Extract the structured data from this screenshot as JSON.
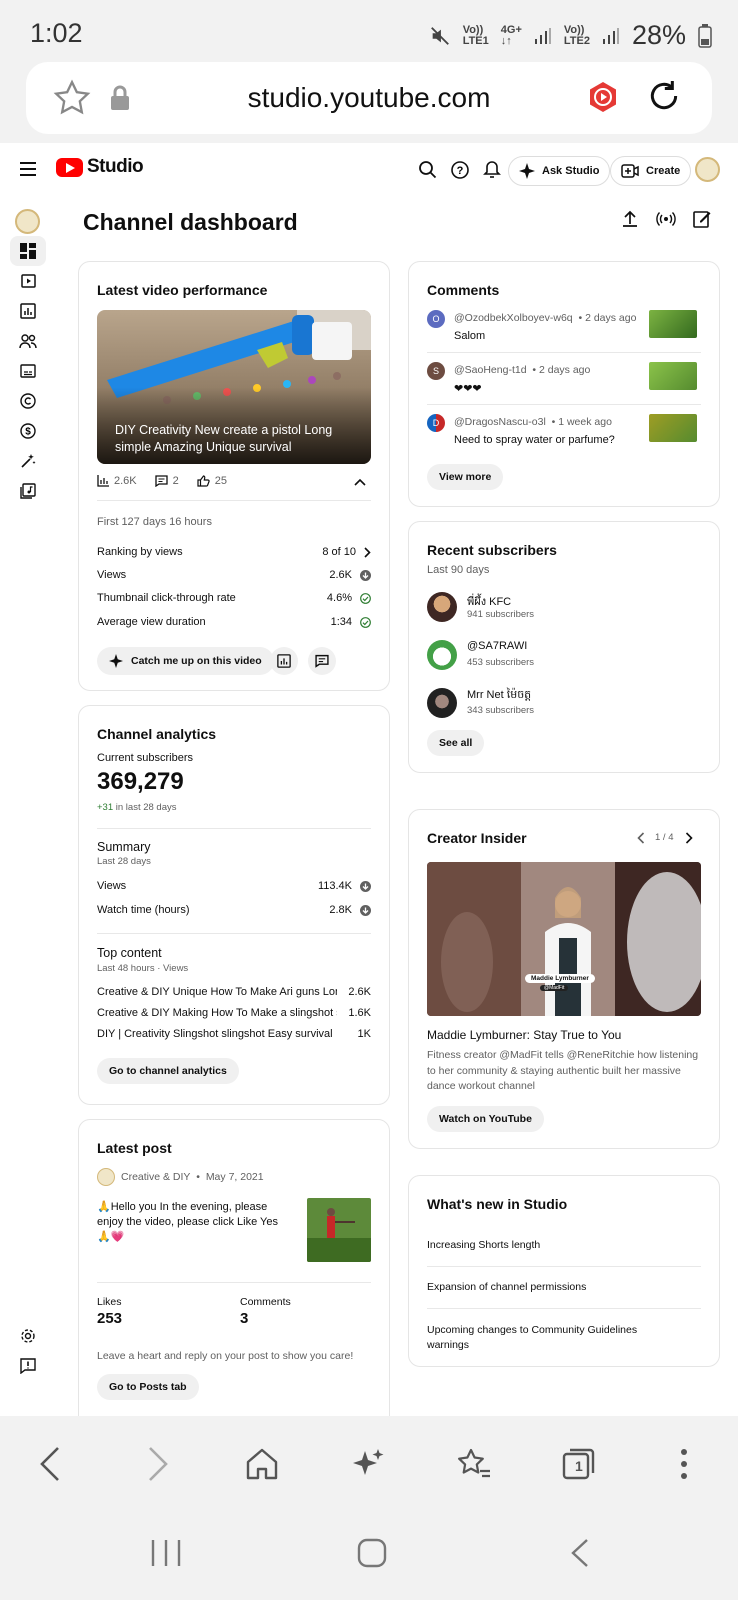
{
  "status": {
    "time": "1:02",
    "net1_top": "Vo))",
    "net1_bottom": "LTE1",
    "net2_top": "4G+",
    "net2_bottom": "↓↑",
    "net3_top": "Vo))",
    "net3_bottom": "LTE2",
    "battery": "28%"
  },
  "browser": {
    "url": "studio.youtube.com"
  },
  "header": {
    "logo_text": "Studio",
    "ask_studio": "Ask Studio",
    "create": "Create"
  },
  "dashboard": {
    "title": "Channel dashboard"
  },
  "latest_video": {
    "title": "Latest video performance",
    "video_title": "DIY Creativity New create a pistol Long simple Amazing Unique survival",
    "views_stat": "2.6K",
    "comments_stat": "2",
    "likes_stat": "25",
    "period": "First 127 days 16 hours",
    "rows": [
      {
        "label": "Ranking by views",
        "value": "8 of 10"
      },
      {
        "label": "Views",
        "value": "2.6K"
      },
      {
        "label": "Thumbnail click-through rate",
        "value": "4.6%"
      },
      {
        "label": "Average view duration",
        "value": "1:34"
      }
    ],
    "catch_up": "Catch me up on this video"
  },
  "analytics": {
    "title": "Channel analytics",
    "current_subs_label": "Current subscribers",
    "current_subs": "369,279",
    "subs_delta": "+31",
    "subs_delta_suffix": " in last 28 days",
    "summary_title": "Summary",
    "summary_period": "Last 28 days",
    "summary_rows": [
      {
        "label": "Views",
        "value": "113.4K"
      },
      {
        "label": "Watch time (hours)",
        "value": "2.8K"
      }
    ],
    "top_title": "Top content",
    "top_period": "Last 48 hours · Views",
    "top_rows": [
      {
        "label": "Creative & DIY Unique How To Make Ari guns Long ...",
        "value": "2.6K"
      },
      {
        "label": "Creative & DIY Making How To Make a slingshot sn...",
        "value": "1.6K"
      },
      {
        "label": "DIY | Creativity Slingshot slingshot Easy survival",
        "value": "1K"
      }
    ],
    "button": "Go to channel analytics"
  },
  "latest_post": {
    "title": "Latest post",
    "channel": "Creative & DIY",
    "date": "May 7, 2021",
    "text": "🙏Hello you In the evening, please enjoy the video, please click Like Yes 🙏💗",
    "likes_label": "Likes",
    "likes": "253",
    "comments_label": "Comments",
    "comments": "3",
    "prompt": "Leave a heart and reply on your post to show you care!",
    "button": "Go to Posts tab"
  },
  "comments": {
    "title": "Comments",
    "items": [
      {
        "initial": "O",
        "user": "@OzodbekXolboyev-w6q",
        "time": "• 2 days ago",
        "text": "Salom"
      },
      {
        "initial": "S",
        "user": "@SaoHeng-t1d",
        "time": "• 2 days ago",
        "text": "❤❤❤"
      },
      {
        "initial": "D",
        "user": "@DragosNascu-o3l",
        "time": "• 1 week ago",
        "text": "Need to spray water or parfume?"
      }
    ],
    "button": "View more"
  },
  "subscribers": {
    "title": "Recent subscribers",
    "period": "Last 90 days",
    "items": [
      {
        "name": "พี่ผึ้ง KFC",
        "count": "941 subscribers"
      },
      {
        "name": "@SA7RAWI",
        "count": "453 subscribers"
      },
      {
        "name": "Mrr Net ម៉ៃចត្ត",
        "count": "343 subscribers"
      }
    ],
    "button": "See all"
  },
  "insider": {
    "title": "Creator Insider",
    "pager": "1 / 4",
    "name_tag": "Maddie Lymburner",
    "handle_tag": "@MadFit",
    "video_title": "Maddie Lymburner: Stay True to You",
    "desc": "Fitness creator @MadFit tells @ReneRitchie how listening to her community & staying authentic built her massive dance workout channel",
    "button": "Watch on YouTube"
  },
  "whats_new": {
    "title": "What's new in Studio",
    "items": [
      "Increasing Shorts length",
      "Expansion of channel permissions",
      "Upcoming changes to Community Guidelines warnings"
    ]
  },
  "browser_nav": {
    "tabs_count": "1"
  },
  "colors": {
    "yt_red": "#ff0000",
    "green_check": "#2e7d32",
    "avatar_o": "#5c6bc0",
    "avatar_s": "#6d4c41"
  }
}
